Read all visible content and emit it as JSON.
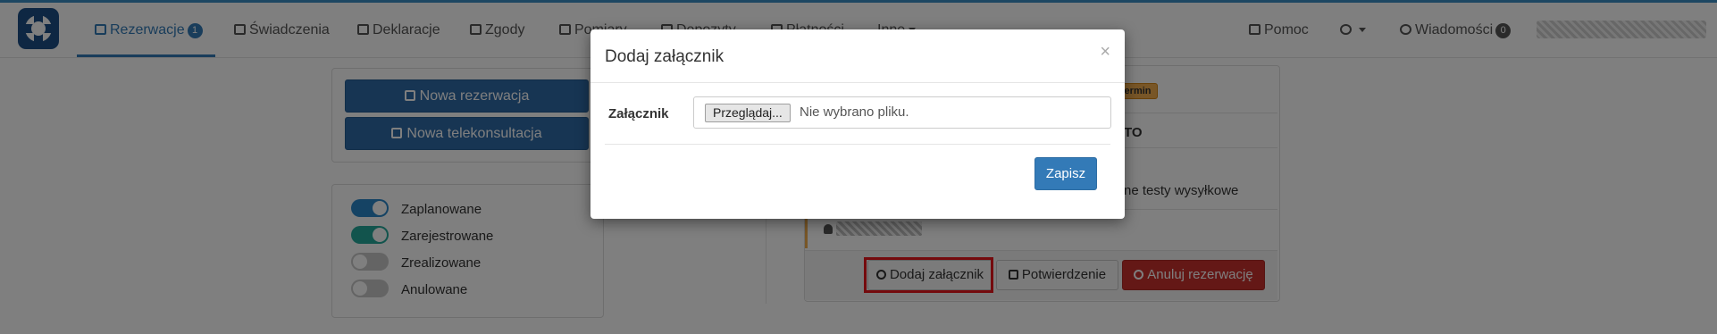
{
  "nav": {
    "items": [
      {
        "label": "Rezerwacje",
        "badge": "1",
        "icon": "calendar-icon",
        "active": true
      },
      {
        "label": "Świadczenia",
        "icon": "medkit-icon"
      },
      {
        "label": "Deklaracje",
        "icon": "document-icon"
      },
      {
        "label": "Zgody",
        "icon": "edit-icon"
      },
      {
        "label": "Pomiary",
        "icon": "bar-chart-icon"
      },
      {
        "label": "Depozyty",
        "icon": "card-icon"
      },
      {
        "label": "Płatności",
        "icon": "card-icon"
      },
      {
        "label": "Inne",
        "icon": "caret-down-icon"
      }
    ],
    "help": "Pomoc",
    "info_icon": "info-icon",
    "messages": "Wiadomości",
    "messages_badge": "0"
  },
  "left": {
    "new_reservation": "Nowa rezerwacja",
    "new_teleconsultation": "Nowa telekonsultacja",
    "filters": [
      {
        "label": "Zaplanowane",
        "state": "on",
        "color": "#2a87c8"
      },
      {
        "label": "Zarejestrowane",
        "state": "on",
        "color": "#24a89a"
      },
      {
        "label": "Zrealizowane",
        "state": "off"
      },
      {
        "label": "Anulowane",
        "state": "off"
      }
    ]
  },
  "reservation": {
    "tag": "eń termin",
    "title_fragment": "TO",
    "service_fragment": "ne testy wysyłkowe",
    "actions": {
      "add_attachment": "Dodaj załącznik",
      "confirmation": "Potwierdzenie",
      "cancel": "Anuluj rezerwację"
    }
  },
  "modal": {
    "title": "Dodaj załącznik",
    "close": "×",
    "label": "Załącznik",
    "browse": "Przeglądaj...",
    "no_file": "Nie wybrano pliku.",
    "save": "Zapisz"
  },
  "colors": {
    "primary": "#337ab7",
    "danger": "#c9302c",
    "highlight": "#e8141b",
    "warning": "#f0ad4e"
  }
}
